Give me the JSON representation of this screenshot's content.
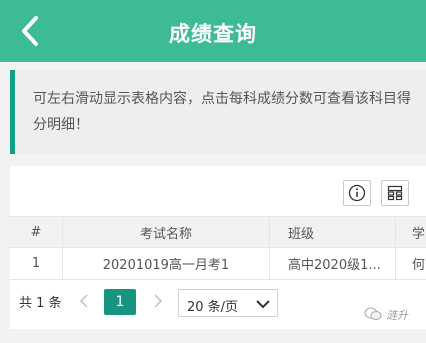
{
  "header": {
    "title": "成绩查询",
    "back_icon": "chevron-left-icon"
  },
  "notice": {
    "text": "可左右滑动显示表格内容，点击每科成绩分数可查看该科目得分明细！",
    "accent": "#14a085"
  },
  "toolbar": {
    "info_icon": "info-circle-icon",
    "columns_icon": "column-filter-icon"
  },
  "table": {
    "headers": [
      "#",
      "考试名称",
      "班级",
      "学"
    ],
    "rows": [
      {
        "idx": "1",
        "name": "20201019高一月考1",
        "class": "高中2020级1...",
        "next": "何"
      }
    ]
  },
  "pagination": {
    "total": "共 1 条",
    "current_page": "1",
    "page_size": "20 条/页",
    "accent": "#169680"
  },
  "watermark": {
    "text": "涟升"
  },
  "colors": {
    "header_bg": "#3dba96",
    "page_bg": "#f2f2f2"
  }
}
